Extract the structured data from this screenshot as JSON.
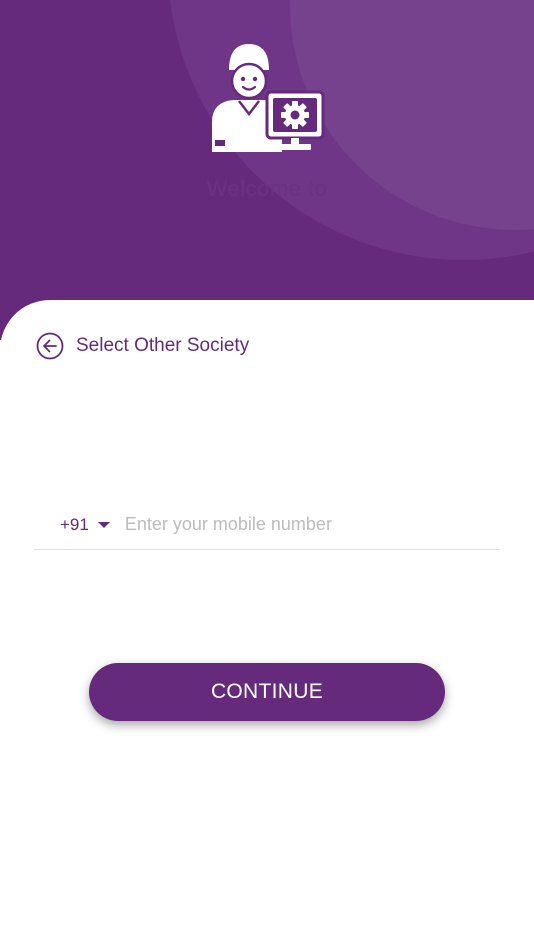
{
  "colors": {
    "primary": "#662a7d",
    "header_circle_outer": "#6f3586",
    "header_circle_inner": "#77428d",
    "placeholder": "#bcbcbc"
  },
  "header": {
    "avatar_icon": "technician-computer-icon",
    "welcome_text": "Welcome to"
  },
  "navigation": {
    "back_icon": "circle-arrow-left-icon",
    "back_label": "Select Other Society"
  },
  "phone": {
    "country_code": "+91",
    "dropdown_icon": "caret-down-icon",
    "placeholder": "Enter your mobile number",
    "value": ""
  },
  "actions": {
    "continue_label": "CONTINUE"
  }
}
